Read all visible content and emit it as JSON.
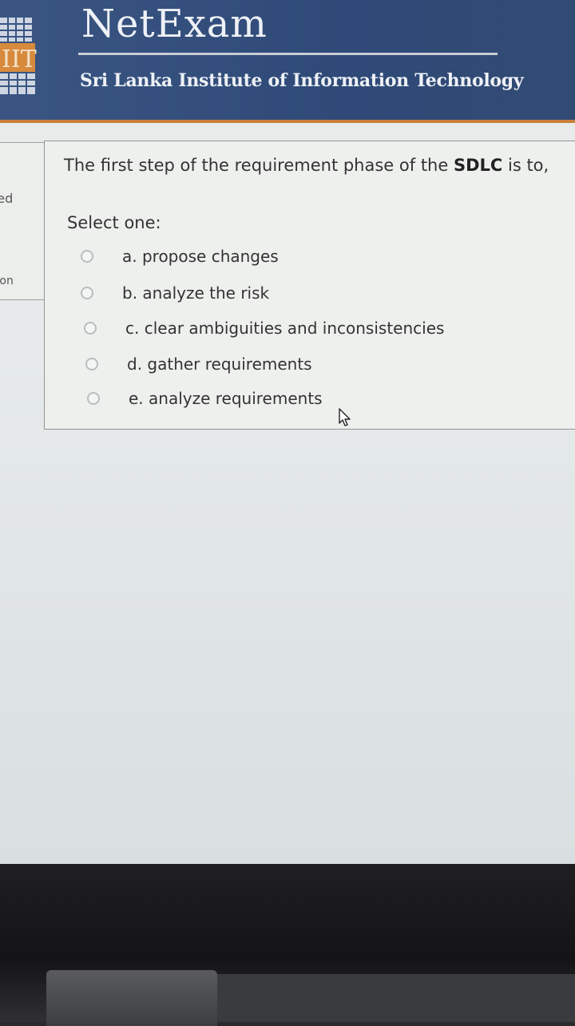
{
  "header": {
    "brand_title": "NetExam",
    "brand_subtitle": "Sri Lanka Institute of Information Technology",
    "logo_text": "IIT",
    "colors": {
      "header_bg": "#2f4a78",
      "accent": "#c9803a"
    }
  },
  "sidebar": {
    "items": [
      {
        "label": "red"
      },
      {
        "label": "tion"
      }
    ]
  },
  "question": {
    "prefix": "The first step of the requirement phase of the ",
    "emphasis": "SDLC",
    "suffix": " is to,",
    "prompt": "Select one:",
    "options": [
      {
        "label": "a. propose changes",
        "selected": false
      },
      {
        "label": "b. analyze the risk",
        "selected": false
      },
      {
        "label": "c. clear ambiguities and inconsistencies",
        "selected": false
      },
      {
        "label": "d. gather requirements",
        "selected": false
      },
      {
        "label": "e. analyze requirements",
        "selected": false
      }
    ]
  },
  "icons": {
    "cursor": "mouse-pointer-icon",
    "logo": "sliit-logo-icon"
  }
}
